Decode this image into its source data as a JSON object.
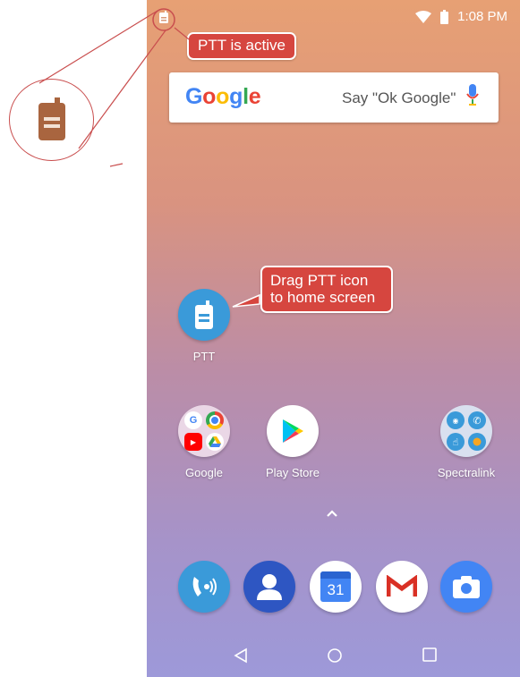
{
  "status": {
    "time": "1:08 PM"
  },
  "annotations": {
    "ptt_active": "PTT is active",
    "drag_line1": "Drag PTT icon",
    "drag_line2": "to home screen"
  },
  "search": {
    "logo": [
      "G",
      "o",
      "o",
      "g",
      "l",
      "e"
    ],
    "hint": "Say \"Ok Google\""
  },
  "apps": {
    "ptt": "PTT",
    "google": "Google",
    "play_store": "Play Store",
    "spectralink": "Spectralink"
  },
  "dock": {
    "calendar_day": "31"
  },
  "colors": {
    "callout": "#d6463f",
    "ptt_blue": "#3a9ad9",
    "ptt_brown": "#a9653f"
  }
}
